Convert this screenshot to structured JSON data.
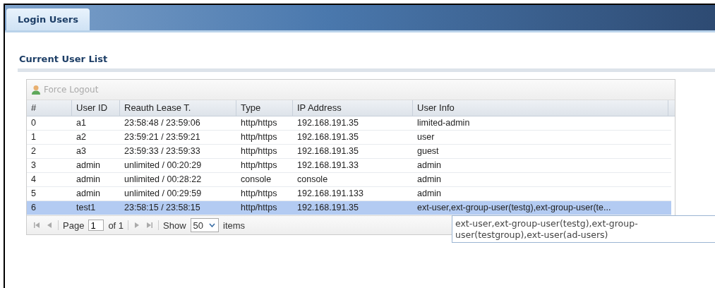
{
  "tabs": [
    {
      "label": "Login Users",
      "selected": true
    }
  ],
  "section_title": "Current User List",
  "toolbar": {
    "force_logout": {
      "label": "Force Logout",
      "disabled": true
    }
  },
  "table": {
    "columns": [
      "#",
      "User ID",
      "Reauth Lease T.",
      "Type",
      "IP Address",
      "User Info"
    ],
    "rows": [
      {
        "cells": [
          "0",
          "a1",
          "23:58:48 / 23:59:06",
          "http/https",
          "192.168.191.35",
          "limited-admin"
        ],
        "selected": false
      },
      {
        "cells": [
          "1",
          "a2",
          "23:59:21 / 23:59:21",
          "http/https",
          "192.168.191.35",
          "user"
        ],
        "selected": false
      },
      {
        "cells": [
          "2",
          "a3",
          "23:59:33 / 23:59:33",
          "http/https",
          "192.168.191.35",
          "guest"
        ],
        "selected": false
      },
      {
        "cells": [
          "3",
          "admin",
          "unlimited / 00:20:29",
          "http/https",
          "192.168.191.33",
          "admin"
        ],
        "selected": false
      },
      {
        "cells": [
          "4",
          "admin",
          "unlimited / 00:28:22",
          "console",
          "console",
          "admin"
        ],
        "selected": false
      },
      {
        "cells": [
          "5",
          "admin",
          "unlimited / 00:29:59",
          "http/https",
          "192.168.191.133",
          "admin"
        ],
        "selected": false
      },
      {
        "cells": [
          "6",
          "test1",
          "23:58:15 / 23:58:15",
          "http/https",
          "192.168.191.35",
          "ext-user,ext-group-user(testg),ext-group-user(te..."
        ],
        "selected": true
      }
    ]
  },
  "pager": {
    "page_label": "Page",
    "page": "1",
    "of_label": "of 1",
    "show_label": "Show",
    "page_size": "50",
    "items_label": "items"
  },
  "tooltip": "ext-user,ext-group-user(testg),ext-group-user(testgroup),ext-user(ad-users)"
}
